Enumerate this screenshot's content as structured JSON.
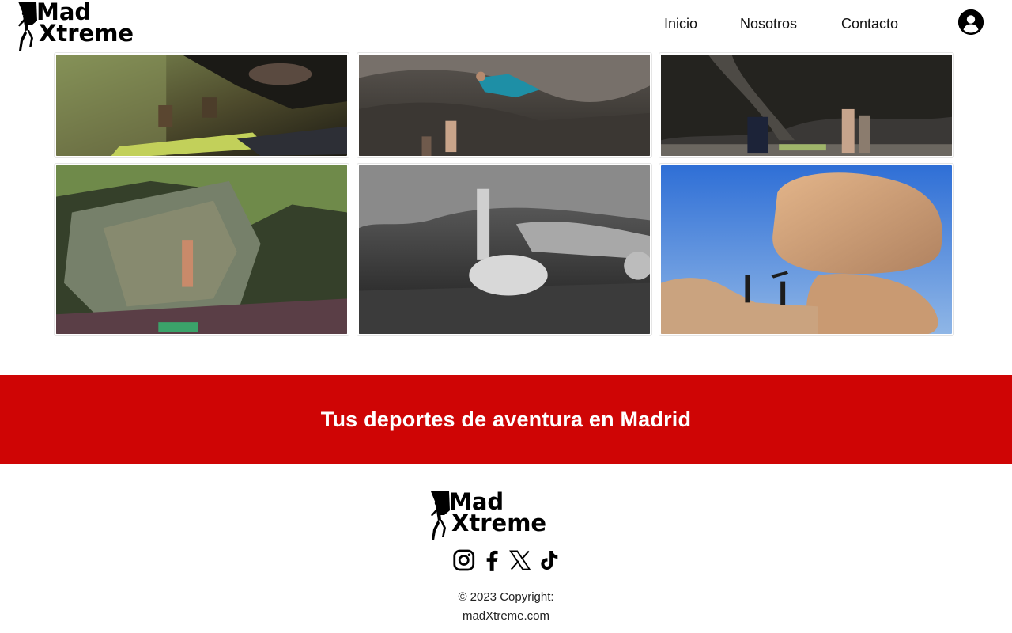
{
  "brand": {
    "line1": "Mad",
    "line2": "Xtreme"
  },
  "nav": {
    "items": [
      "Inicio",
      "Nosotros",
      "Contacto"
    ],
    "user_icon": "user-circle-icon"
  },
  "gallery": {
    "photos": [
      {
        "subject": "climber on bouldering crash pads in a forest"
      },
      {
        "subject": "climber on overhanging cave wall with spotters"
      },
      {
        "subject": "climbers looking up at a dark rock face"
      },
      {
        "subject": "climber on a mossy boulder in the woods"
      },
      {
        "subject": "black and white climber under a rock roof"
      },
      {
        "subject": "climber hanging from a giant balanced boulder under blue sky"
      }
    ]
  },
  "banner": {
    "text": "Tus deportes de aventura en Madrid",
    "color": "#cf0505"
  },
  "footer": {
    "socials": [
      "instagram-icon",
      "facebook-icon",
      "x-icon",
      "tiktok-icon"
    ],
    "copyright_line1": "© 2023 Copyright:",
    "copyright_line2": "madXtreme.com"
  }
}
